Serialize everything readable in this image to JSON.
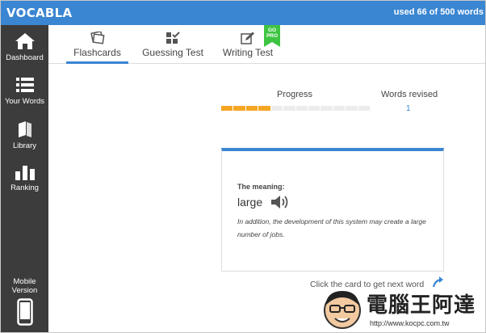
{
  "app": {
    "logo": "VOCABLA",
    "usage": "used 66 of 500 words",
    "accent": "#3a86d2"
  },
  "sidebar": {
    "items": [
      {
        "label": "Dashboard",
        "icon": "home-icon"
      },
      {
        "label": "Your Words",
        "icon": "list-icon"
      },
      {
        "label": "Library",
        "icon": "books-icon"
      },
      {
        "label": "Ranking",
        "icon": "bar-chart-icon"
      }
    ],
    "mobile": {
      "line1": "Mobile",
      "line2": "Version",
      "icon": "mobile-phone-icon"
    }
  },
  "tabs": [
    {
      "label": "Flashcards",
      "icon": "flashcards-icon",
      "active": true
    },
    {
      "label": "Guessing Test",
      "icon": "grid-check-icon",
      "active": false
    },
    {
      "label": "Writing Test",
      "icon": "pencil-icon",
      "active": false
    }
  ],
  "go_pro": {
    "line1": "GO",
    "line2": "PRO",
    "color": "#3ec442"
  },
  "progress": {
    "label": "Progress",
    "segments_total": 12,
    "segments_filled": 4,
    "fill_color": "#f5a623"
  },
  "revised": {
    "label": "Words revised",
    "count": "1"
  },
  "card": {
    "meaning_label": "The meaning:",
    "word": "large",
    "speaker_icon": "speaker-icon",
    "example": "In addition, the development of this system may create a large number of jobs."
  },
  "hint": {
    "text": "Click the card to get next word",
    "icon": "curved-arrow-icon"
  },
  "watermark": {
    "title": "電腦王阿達",
    "url": "http://www.kocpc.com.tw"
  }
}
